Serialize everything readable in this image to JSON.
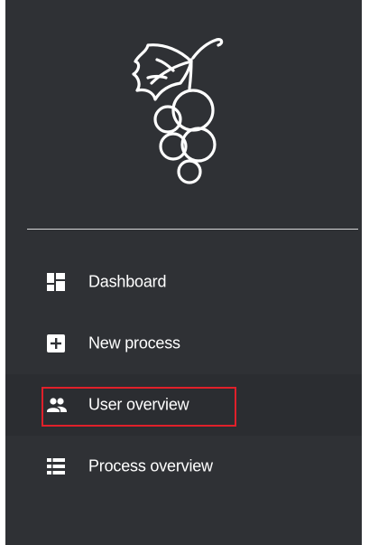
{
  "sidebar": {
    "logo_icon": "grape-icon",
    "nav_items": [
      {
        "label": "Dashboard",
        "icon": "dashboard-icon"
      },
      {
        "label": "New process",
        "icon": "plus-box-icon"
      },
      {
        "label": "User overview",
        "icon": "users-icon",
        "active": true,
        "highlighted": true
      },
      {
        "label": "Process overview",
        "icon": "list-icon"
      }
    ]
  },
  "colors": {
    "sidebar_bg": "#2f3135",
    "text": "#ffffff",
    "highlight_border": "#e0202a"
  }
}
